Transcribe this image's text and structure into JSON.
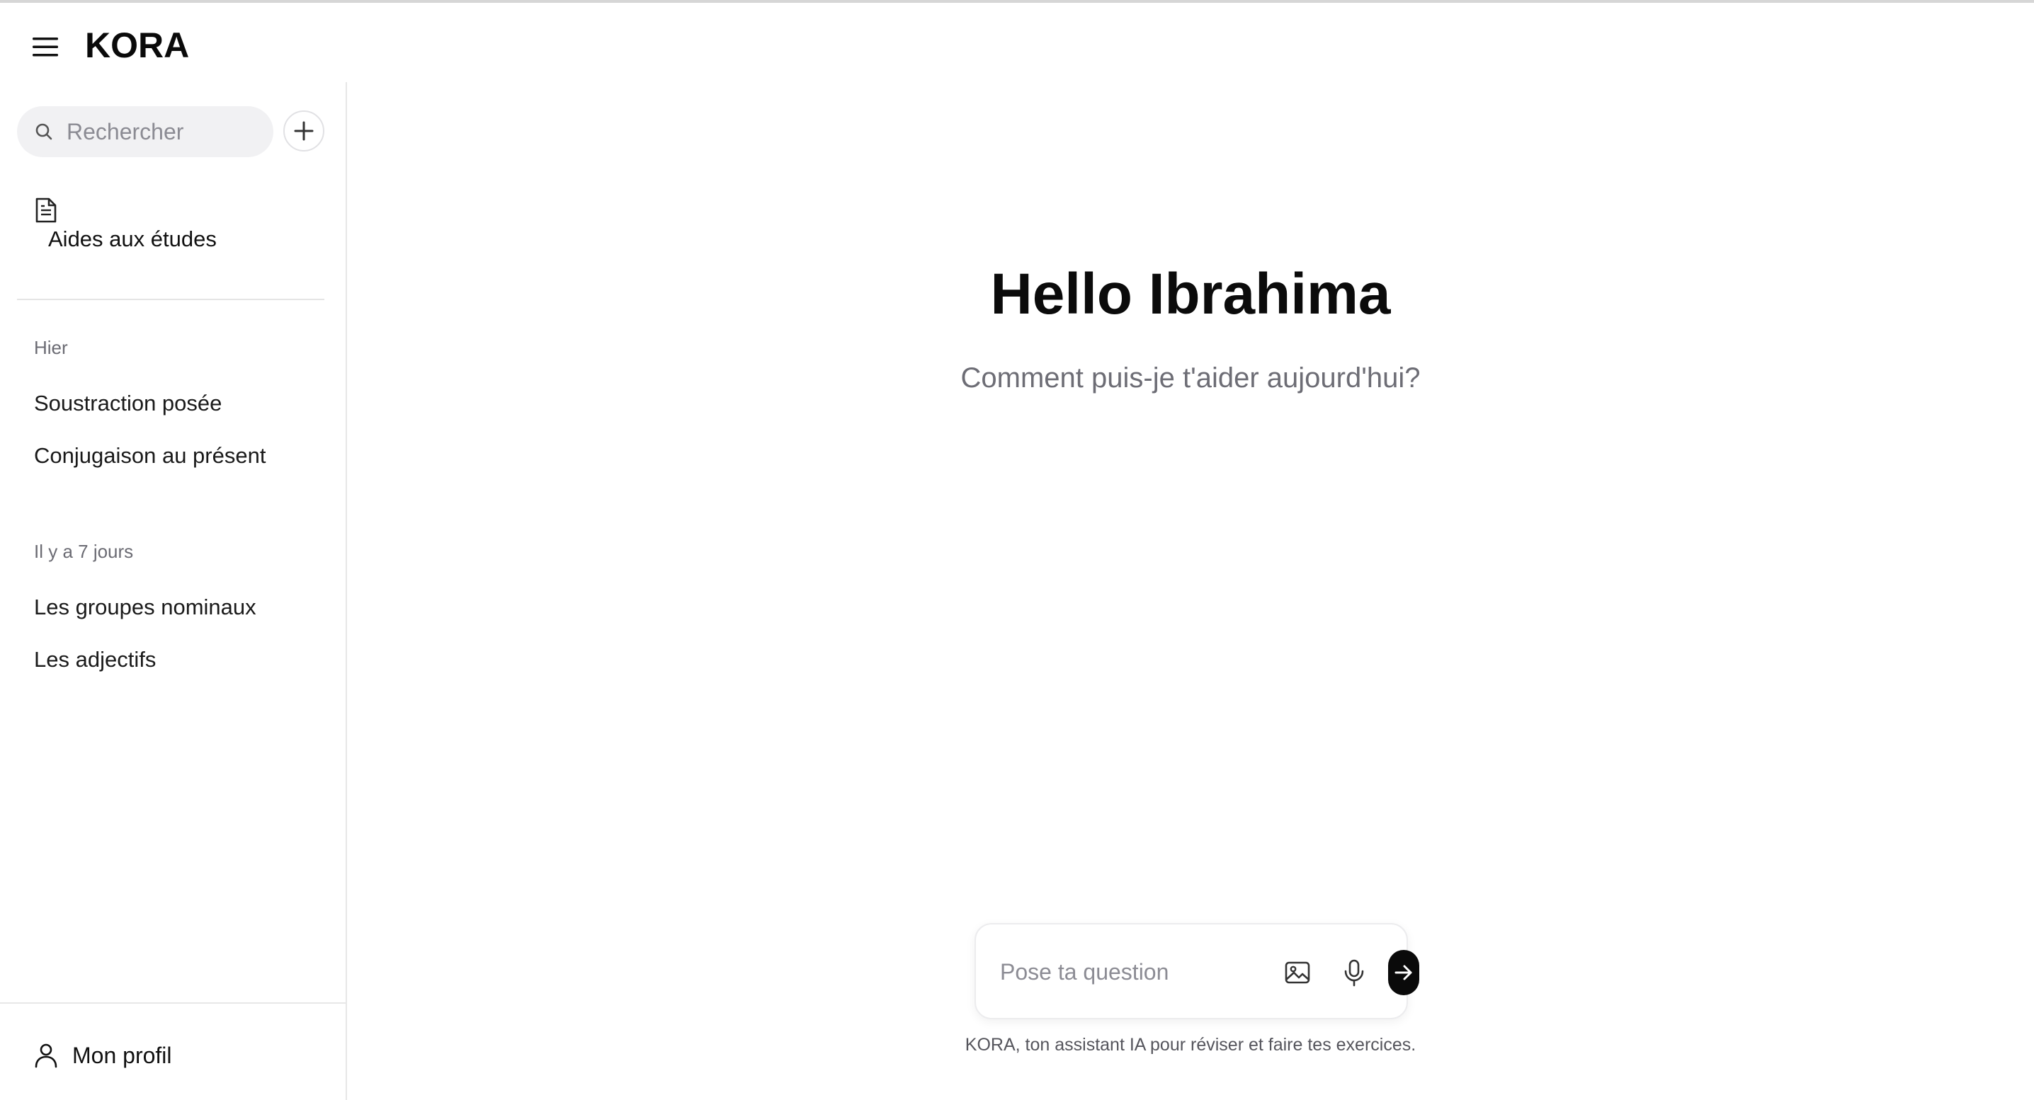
{
  "app": {
    "logo": "KORA"
  },
  "header": {
    "menu_icon": "hamburger-menu-icon"
  },
  "sidebar": {
    "search": {
      "placeholder": "Rechercher",
      "icon": "search-icon"
    },
    "new_chat_icon": "plus-icon",
    "study_aids": {
      "label": "Aides aux études",
      "icon": "document-icon"
    },
    "sections": [
      {
        "title": "Hier",
        "items": [
          "Soustraction posée",
          "Conjugaison au présent"
        ]
      },
      {
        "title": "Il y a 7 jours",
        "items": [
          "Les groupes nominaux",
          "Les adjectifs"
        ]
      }
    ],
    "profile": {
      "label": "Mon profil",
      "icon": "user-icon"
    }
  },
  "main": {
    "greeting": "Hello Ibrahima",
    "subtitle": "Comment puis-je t'aider aujourd'hui?",
    "composer": {
      "placeholder": "Pose ta question",
      "image_icon": "image-icon",
      "mic_icon": "microphone-icon",
      "send_icon": "arrow-right-icon"
    },
    "footer_note": "KORA, ton assistant IA pour réviser et faire tes exercices."
  },
  "colors": {
    "accent": "#0a0a0a",
    "muted_text": "#6d6d75",
    "search_bg": "#f1f1f3",
    "border": "#e7e7e7"
  }
}
